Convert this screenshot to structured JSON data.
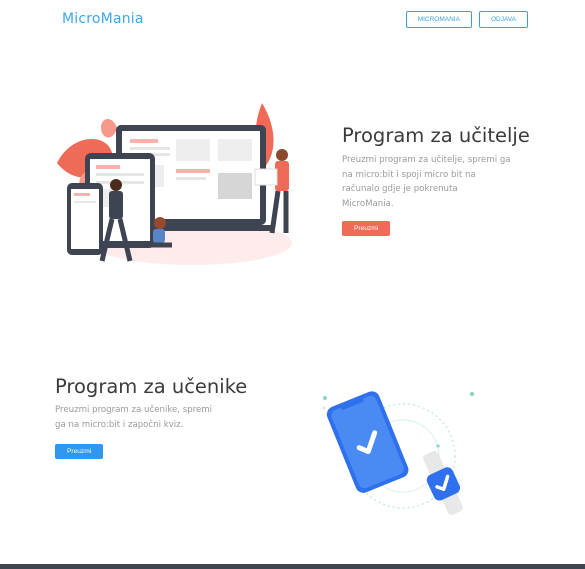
{
  "header": {
    "brand": "MicroMania",
    "nav": [
      "MICROMANIA",
      "ODJAVA"
    ]
  },
  "teacher_section": {
    "title": "Program za učitelje",
    "description_lines": [
      "Preuzmi program za učitelje, spremi ga",
      "na micro:bit i spoji micro bit na",
      "računalo gdje je pokrenuta",
      "MicroMania."
    ],
    "button": "Preuzmi",
    "illustration": "devices-people-illustration",
    "accent_color": "#ef6a57"
  },
  "student_section": {
    "title": "Program za učenike",
    "description_lines": [
      "Preuzmi program za učenike, spremi",
      "ga na micro:bit i započni kviz."
    ],
    "button": "Preuzmi",
    "illustration": "phone-smartwatch-check-illustration",
    "accent_color": "#2f97ee"
  },
  "colors": {
    "brand": "#3aa8ec",
    "footer": "#3e4452"
  }
}
